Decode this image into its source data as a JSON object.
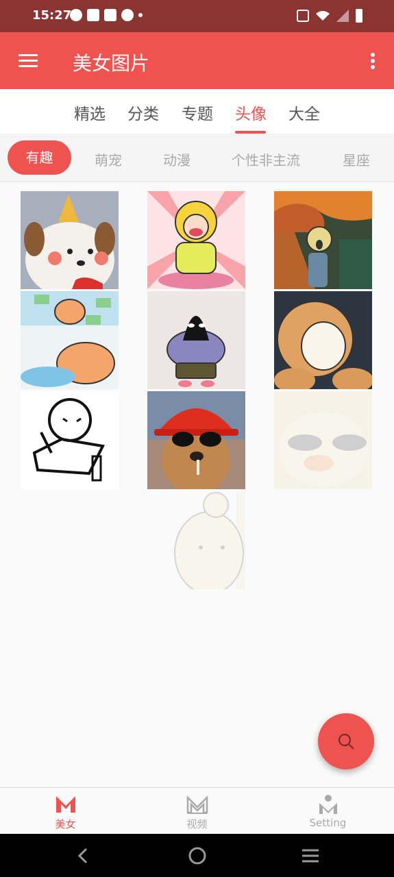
{
  "status_bar": {
    "time": "15:27",
    "notification_icons": [
      "speed-icon",
      "mail-icon",
      "mail-icon",
      "shield-icon",
      "dot-icon"
    ],
    "right_icons": [
      "vibrate-icon",
      "wifi-icon",
      "signal-icon",
      "battery-icon"
    ]
  },
  "app_bar": {
    "title": "美女图片",
    "background": "#ef5350"
  },
  "main_tabs": [
    {
      "label": "精选",
      "active": false
    },
    {
      "label": "分类",
      "active": false
    },
    {
      "label": "专题",
      "active": false
    },
    {
      "label": "头像",
      "active": true
    },
    {
      "label": "大全",
      "active": false
    }
  ],
  "sub_tabs": [
    {
      "label": "有趣",
      "active": true
    },
    {
      "label": "萌宠",
      "active": false
    },
    {
      "label": "动漫",
      "active": false
    },
    {
      "label": "个性非主流",
      "active": false
    },
    {
      "label": "星座",
      "active": false
    }
  ],
  "grid_images": [
    {
      "subject": "cartoon puppy with party hat"
    },
    {
      "subject": "cartoon girl cheering"
    },
    {
      "subject": "the scream parody"
    },
    {
      "subject": "bear with money"
    },
    {
      "subject": "patrick star cartoon"
    },
    {
      "subject": "cat in taiyaki"
    },
    {
      "subject": "doodle doing homework"
    },
    {
      "subject": "dog with hard hat"
    },
    {
      "subject": "duck with sunglasses (loading)"
    },
    {
      "subject": "bear peeking (loading)"
    }
  ],
  "fab": {
    "icon": "search-icon"
  },
  "bottom_nav": [
    {
      "label": "美女",
      "icon": "m-logo-icon",
      "active": true
    },
    {
      "label": "视频",
      "icon": "m-logo-icon",
      "active": false
    },
    {
      "label": "Setting",
      "icon": "person-icon",
      "active": false
    }
  ],
  "accent_color": "#ef5350"
}
